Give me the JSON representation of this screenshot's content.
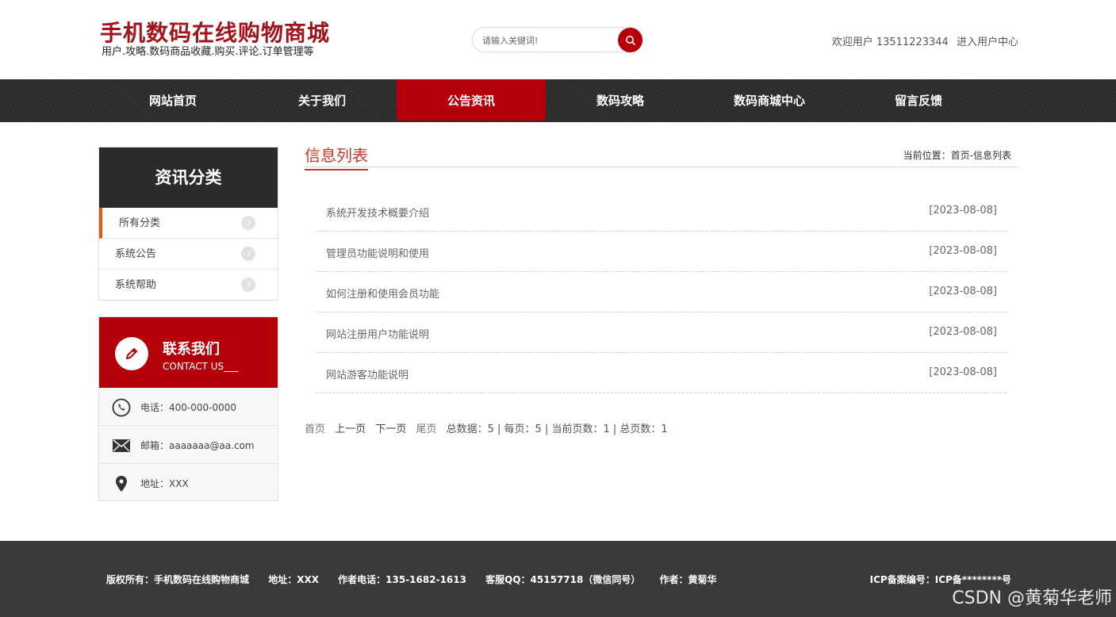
{
  "header": {
    "site_title": "手机数码在线购物商城",
    "site_subtitle": "用户.攻略.数码商品收藏.购买.评论.订单管理等",
    "search_placeholder": "请输入关键词!",
    "welcome_text": "欢迎用户 13511223344",
    "user_center_link": "进入用户中心"
  },
  "nav": {
    "items": [
      {
        "label": "网站首页"
      },
      {
        "label": "关于我们"
      },
      {
        "label": "公告资讯",
        "active": true
      },
      {
        "label": "数码攻略"
      },
      {
        "label": "数码商城中心"
      },
      {
        "label": "留言反馈"
      }
    ]
  },
  "sidebar": {
    "categories_title": "资讯分类",
    "categories": [
      {
        "label": "所有分类",
        "active": true
      },
      {
        "label": "系统公告"
      },
      {
        "label": "系统帮助"
      }
    ],
    "contact": {
      "title": "联系我们",
      "subtitle": "CONTACT US___",
      "phone": "电话：400-000-0000",
      "email": "邮箱：aaaaaaa@aa.com",
      "address": "地址：XXX"
    }
  },
  "main": {
    "title": "信息列表",
    "breadcrumb": "当前位置：首页-信息列表",
    "items": [
      {
        "title": "系统开发技术概要介绍",
        "date": "[2023-08-08]"
      },
      {
        "title": "管理员功能说明和使用",
        "date": "[2023-08-08]"
      },
      {
        "title": "如何注册和使用会员功能",
        "date": "[2023-08-08]"
      },
      {
        "title": "网站注册用户功能说明",
        "date": "[2023-08-08]"
      },
      {
        "title": "网站游客功能说明",
        "date": "[2023-08-08]"
      }
    ],
    "pager": {
      "first": "首页",
      "prev": "上一页",
      "next": "下一页",
      "last": "尾页",
      "summary": "总数据：5 | 每页：5 | 当前页数：1 | 总页数：1"
    }
  },
  "footer": {
    "copyright": "版权所有：手机数码在线购物商城",
    "address": "地址：XXX",
    "phone": "作者电话：135-1682-1613",
    "qq": "客服QQ：45157718（微信同号）",
    "author": "作者：黄菊华",
    "icp": "ICP备案编号：ICP备********号",
    "watermark": "CSDN @黄菊华老师"
  },
  "colors": {
    "brand_red": "#b5000a",
    "nav_dark": "#2b2b2b",
    "footer_dark": "#3a3a3a",
    "category_accent": "#e05b10"
  }
}
